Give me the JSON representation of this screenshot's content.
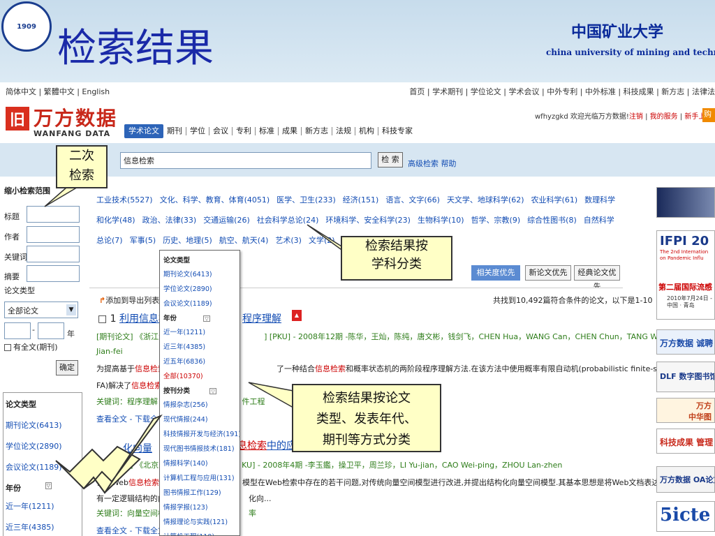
{
  "slide": {
    "title": "检索结果",
    "logo_text": "1909",
    "university_cn": "中国矿业大学",
    "university_en": "china university of mining and technology"
  },
  "lang_bar": "简体中文 | 繁體中文 | English",
  "top_nav": "首页 | 学术期刊 | 学位论文 | 学术会议 | 中外专利 | 中外标准 | 科技成果 | 新方志 | 法律法",
  "wanfang": {
    "mark": "旧",
    "name_cn": "万方数据",
    "name_en": "WANFANG DATA"
  },
  "user_bar": {
    "welcome": "wfhyzgkd 欢迎光临万方数据!",
    "logout": "注销",
    "service": "我的服务",
    "new_user": "新手上路",
    "pay": "购"
  },
  "db_tabs": [
    "学术论文",
    "期刊",
    "学位",
    "会议",
    "专利",
    "标准",
    "成果",
    "新方志",
    "法规",
    "机构",
    "科技专家"
  ],
  "search": {
    "value": "信息检索",
    "button": "检 索",
    "advanced": "高级检索",
    "help": "帮助"
  },
  "narrow": {
    "title": "缩小检索范围",
    "title_label": "标题",
    "author_label": "作者",
    "keyword_label": "关键词",
    "abstract_label": "摘要",
    "doctype_label": "论文类型",
    "doctype_value": "全部论文",
    "year_unit": "年",
    "fulltext": "有全文(期刊)",
    "confirm": "确定"
  },
  "left_facet": {
    "heading": "论文类型",
    "items": [
      "期刊论文(6413)",
      "学位论文(2890)",
      "会议论文(1189)"
    ],
    "year_heading": "年份",
    "year_items": [
      "近一年(1211)",
      "近三年(4385)"
    ]
  },
  "subject_categories": [
    "工业技术(5527)",
    "文化、科学、教育、体育(4051)",
    "医学、卫生(233)",
    "经济(151)",
    "语言、文字(66)",
    "天文学、地球科学(62)",
    "农业科学(61)",
    "数理科学和化学(48)",
    "政治、法律(33)",
    "交通运输(26)",
    "社会科学总论(24)",
    "环境科学、安全科学(23)",
    "生物科学(10)",
    "哲学、宗教(9)",
    "综合性图书(8)",
    "自然科学总论(7)",
    "军事(5)",
    "历史、地理(5)",
    "航空、航天(4)",
    "艺术(3)",
    "文学(2)"
  ],
  "sort": {
    "relevance": "相关度优先",
    "new": "新论文优先",
    "classic": "经典论文优先"
  },
  "results": {
    "export": "添加到导出列表 /",
    "count": "共找到10,492篇符合条件的论文，以下是1-10",
    "r1": {
      "num": "□ 1",
      "title_a": "利用",
      "title_hl": "信息检",
      "title_b": "程序理解",
      "meta_a": "[期刊论文]  《浙江大",
      "meta_b": "] [PKU] - 2008年12期 -陈华，王灿，陈纯，唐文彬，钱剑飞，CHEN Hua，WANG Can，CHEN Chun，TANG Wen-bin，QIAN",
      "meta2": "Jian-fei",
      "abs_a": "为提高基于",
      "abs_hl": "信息检索",
      "abs_b": "的",
      "abs_c": "了一种结合",
      "abs_hl2": "信息检索",
      "abs_d": "和概率状态机的两阶段程序理解方法.在该方法中使用概率有限自动机(probabilistic finite-state automata,P",
      "abs2_a": "FA)解决了",
      "abs2_hl": "信息检索",
      "abs2_b": "结",
      "kw": "关键词：程序理解  概",
      "kw_b": "件工程",
      "links": "查看全文 - 下载全"
    },
    "r2": {
      "title_a": "化向量",
      "title_hl": "息检索",
      "title_b": "中的应",
      "meta_a": "[期刊论文]  《北京工",
      "meta_b": "KU] - 2008年4期 -李玉鑑，操卫平，周兰珍，LI Yu-jian，CAO Wei-ping，ZHOU Lan-zhen",
      "abs_a": "针对Web",
      "abs_hl": "信息检索",
      "abs_b": "的",
      "abs_c": "模型在Web检索中存在的若干问题,对传统向量空间模型进行改进,并提出结构化向量空间模型.其基本思想是将Web文档表达为具",
      "abs2": "有一定逻辑结构的向量",
      "abs2_b": "化向...",
      "kw": "关键词：向量空间模型",
      "kw_b": "率",
      "links": "查看全文 - 下载全文"
    }
  },
  "popup": {
    "heading": "论文类型",
    "types": [
      "期刊论文(6413)",
      "学位论文(2890)",
      "会议论文(1189)"
    ],
    "year_heading": "年份",
    "years": [
      "近一年(1211)",
      "近三年(4385)",
      "近五年(6836)"
    ],
    "all": "全部(10370)",
    "journal_heading": "按刊分类",
    "journals": [
      "情报杂志(256)",
      "现代情报(244)",
      "科技情报开发与经济(191)",
      "现代图书情报技术(181)",
      "情报科学(140)",
      "计算机工程与应用(131)",
      "图书情报工作(129)",
      "情报学报(123)",
      "情报理论与实践(121)",
      "计算机工程(110)"
    ]
  },
  "callouts": {
    "secondary": [
      "二次",
      "检索"
    ],
    "subject": [
      "检索结果按",
      "学科分类"
    ],
    "type": [
      "检索结果按论文",
      "类型、发表年代、",
      "期刊等方式分类"
    ]
  },
  "ads": {
    "ifpi": "IFPI 20",
    "ifpi_sub": [
      "The 2nd Internation",
      "on Pandemic Influ"
    ],
    "ifpi_cn": "第二届国际流感",
    "ifpi_date": [
      "2010年7月24日 - 2",
      "中国 · 青岛"
    ],
    "wanfang_sub": "万方数据 诚聘",
    "dlf": "DLF 数字图书馆",
    "zhongnian": [
      "万方",
      "中华图"
    ],
    "kejichengguo": "科技成果 管理",
    "oa": "万方数据 OA论文托管",
    "fivecte": "5icte"
  }
}
